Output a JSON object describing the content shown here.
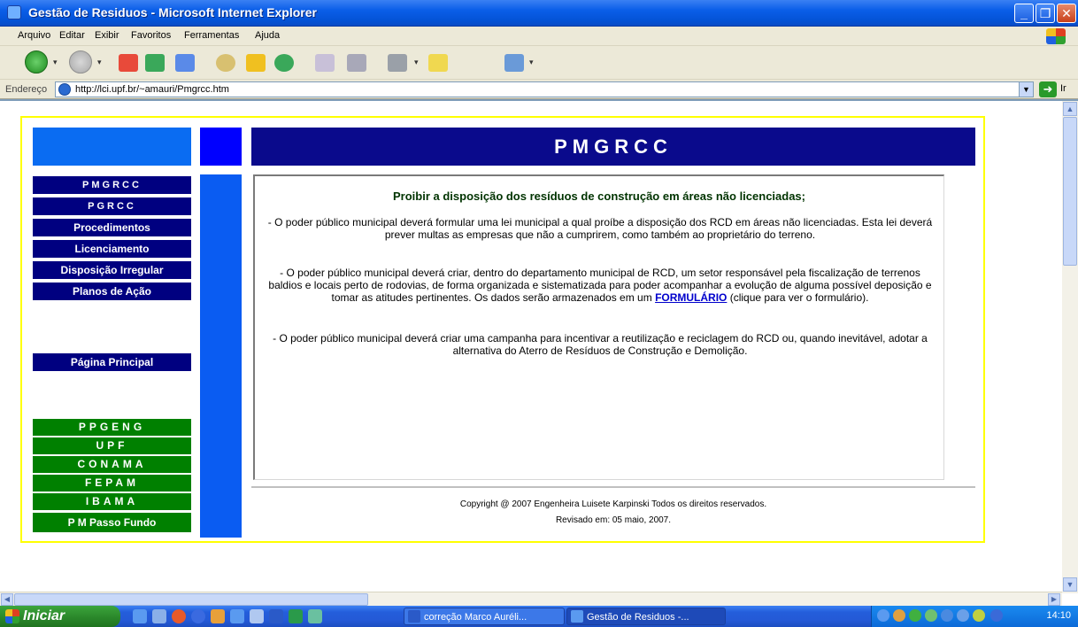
{
  "window": {
    "title": "Gestão de Residuos - Microsoft Internet Explorer"
  },
  "menu": {
    "items": [
      "Arquivo",
      "Editar",
      "Exibir",
      "Favoritos",
      "Ferramentas",
      "Ajuda"
    ]
  },
  "address": {
    "label": "Endereço",
    "url": "http://lci.upf.br/~amauri/Pmgrcc.htm",
    "go_label": "Ir"
  },
  "page": {
    "banner": "PMGRCC",
    "nav": [
      "PMGRCC",
      "PGRCC",
      "Procedimentos",
      "Licenciamento",
      "Disposição Irregular",
      "Planos de Ação"
    ],
    "home": "Página Principal",
    "links": [
      "PPGENG",
      "UPF",
      "CONAMA",
      "FEPAM",
      "IBAMA",
      "P M Passo Fundo"
    ],
    "heading": "Proibir a disposição dos resíduos de construção em áreas não licenciadas;",
    "p1": "- O poder público municipal deverá formular uma lei municipal a qual proíbe a disposição dos RCD em áreas não licenciadas. Esta lei deverá prever multas as empresas que não a cumprirem, como também ao proprietário do terreno.",
    "p2_before": "- O poder público municipal deverá criar, dentro do departamento municipal de RCD, um setor responsável pela fiscalização de terrenos baldios e locais perto de rodovias, de forma organizada e sistematizada para poder acompanhar a evolução de alguma possível deposição e tomar as atitudes pertinentes. Os dados serão armazenados em um ",
    "p2_link": "FORMULÁRIO",
    "p2_after": " (clique para ver o formulário).",
    "p3": "- O poder público municipal deverá criar uma campanha para incentivar a reutilização e reciclagem do RCD ou, quando inevitável, adotar a alternativa do Aterro de Resíduos de Construção e Demolição.",
    "copyright": "Copyright @ 2007 Engenheira Luisete Karpinski Todos os direitos reservados.",
    "revised": "Revisado em: 05 maio, 2007."
  },
  "taskbar": {
    "start": "Iniciar",
    "tasks": [
      "correção Marco Auréli...",
      "Gestão de Residuos -..."
    ],
    "clock": "14:10"
  },
  "colors": {
    "banner": "#0a0a8c",
    "nav": "#000080",
    "links": "#008000",
    "frame": "#ffff00"
  }
}
